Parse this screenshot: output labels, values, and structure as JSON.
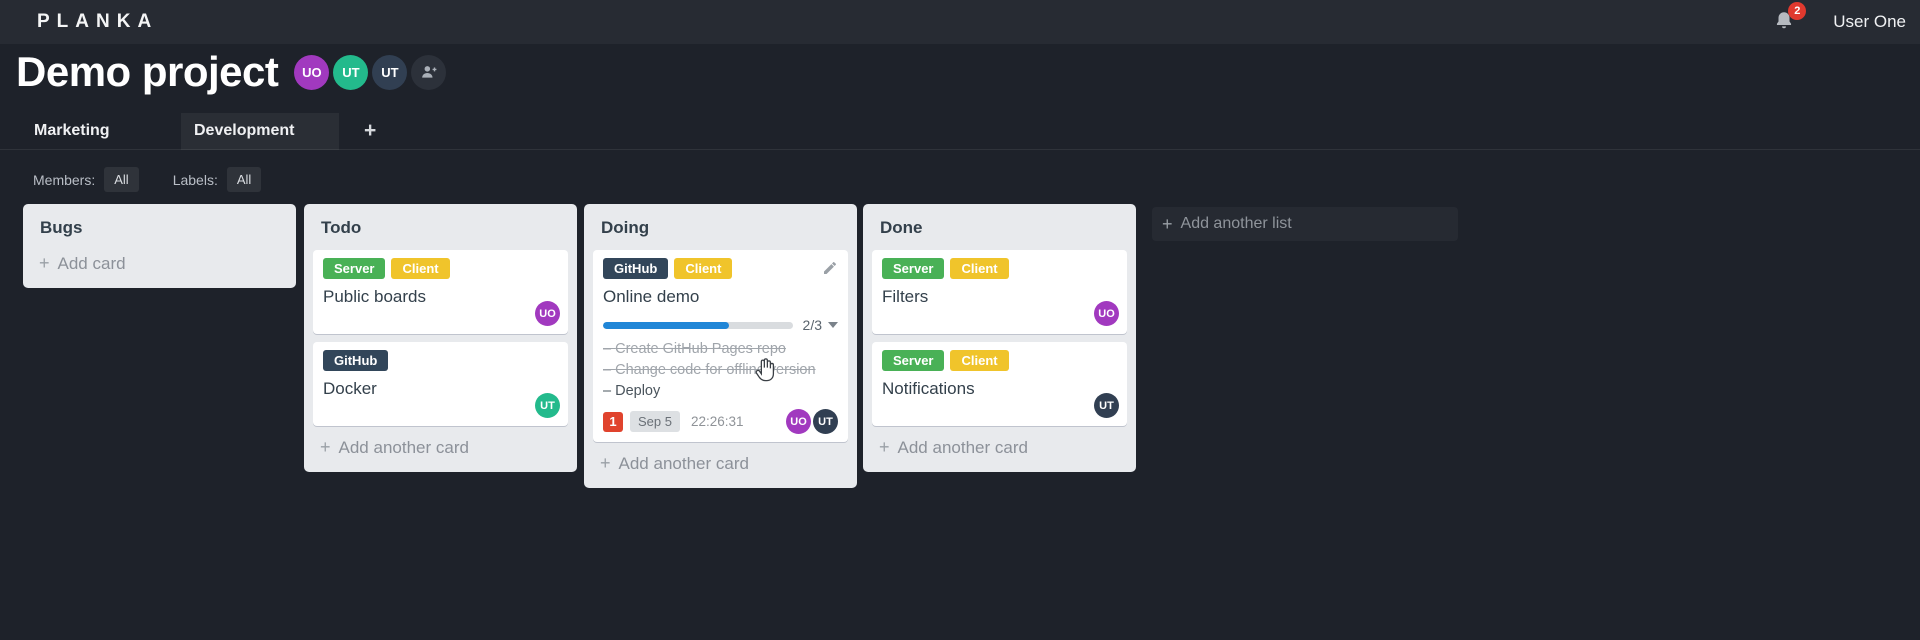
{
  "topbar": {
    "logo": "PLANKA",
    "notifications_count": "2",
    "user_name": "User One"
  },
  "project": {
    "title": "Demo project",
    "members": [
      {
        "initials": "UO"
      },
      {
        "initials": "UT"
      },
      {
        "initials": "UT"
      }
    ]
  },
  "tabs": {
    "items": [
      {
        "label": "Marketing",
        "active": false
      },
      {
        "label": "Development",
        "active": true
      }
    ],
    "add_label": "+"
  },
  "filters": {
    "members_label": "Members:",
    "members_value": "All",
    "labels_label": "Labels:",
    "labels_value": "All"
  },
  "board": {
    "add_list_plus": "+",
    "add_list_label": "Add another list",
    "lists": [
      {
        "name": "Bugs",
        "add_plus": "+",
        "add_label": "Add card",
        "cards": []
      },
      {
        "name": "Todo",
        "add_plus": "+",
        "add_label": "Add another card",
        "cards": [
          {
            "title": "Public boards",
            "labels": [
              "Server",
              "Client"
            ],
            "assignees": [
              "UO"
            ]
          },
          {
            "title": "Docker",
            "labels": [
              "GitHub"
            ],
            "assignees": [
              "UT"
            ]
          }
        ]
      },
      {
        "name": "Doing",
        "add_plus": "+",
        "add_label": "Add another card",
        "cards": [
          {
            "title": "Online demo",
            "labels": [
              "GitHub",
              "Client"
            ],
            "progress": {
              "completed": 2,
              "total": 3,
              "display": "2/3"
            },
            "tasks": [
              {
                "text": "Create GitHub Pages repo",
                "done": true
              },
              {
                "text": "Change code for offline version",
                "done": true
              },
              {
                "text": "Deploy",
                "done": false
              }
            ],
            "notification_count": "1",
            "due_date": "Sep 5",
            "timer": "22:26:31",
            "assignees": [
              "UO",
              "UT"
            ]
          }
        ]
      },
      {
        "name": "Done",
        "add_plus": "+",
        "add_label": "Add another card",
        "cards": [
          {
            "title": "Filters",
            "labels": [
              "Server",
              "Client"
            ],
            "assignees": [
              "UO"
            ]
          },
          {
            "title": "Notifications",
            "labels": [
              "Server",
              "Client"
            ],
            "assignees": [
              "UT"
            ]
          }
        ]
      }
    ]
  },
  "colors": {
    "label_server": "#49b156",
    "label_client": "#f0c42b",
    "label_github": "#32465a",
    "avatar_uo": "#a139bf",
    "avatar_ut_teal": "#23ba8c",
    "avatar_ut_navy": "#313f52",
    "progress_blue": "#2086d7",
    "notification_red": "#e0392e",
    "due_badge_red": "#e0432d"
  }
}
